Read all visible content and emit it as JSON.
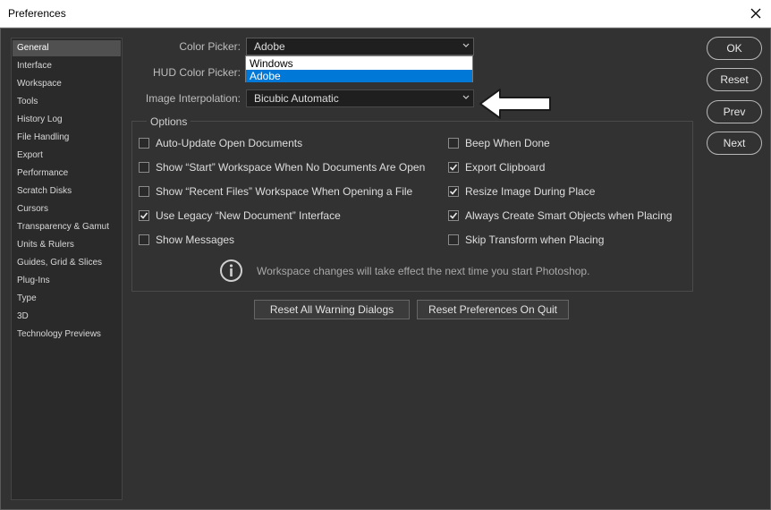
{
  "window": {
    "title": "Preferences"
  },
  "sidebar": {
    "items": [
      {
        "label": "General",
        "selected": true
      },
      {
        "label": "Interface"
      },
      {
        "label": "Workspace"
      },
      {
        "label": "Tools"
      },
      {
        "label": "History Log"
      },
      {
        "label": "File Handling"
      },
      {
        "label": "Export"
      },
      {
        "label": "Performance"
      },
      {
        "label": "Scratch Disks"
      },
      {
        "label": "Cursors"
      },
      {
        "label": "Transparency & Gamut"
      },
      {
        "label": "Units & Rulers"
      },
      {
        "label": "Guides, Grid & Slices"
      },
      {
        "label": "Plug-Ins"
      },
      {
        "label": "Type"
      },
      {
        "label": "3D"
      },
      {
        "label": "Technology Previews"
      }
    ]
  },
  "fields": {
    "color_picker": {
      "label": "Color Picker:",
      "value": "Adobe",
      "options": [
        "Windows",
        "Adobe"
      ],
      "selected_option": "Adobe",
      "open": true
    },
    "hud_color_picker": {
      "label": "HUD Color Picker:"
    },
    "image_interpolation": {
      "label": "Image Interpolation:",
      "value": "Bicubic Automatic"
    }
  },
  "options": {
    "legend": "Options",
    "left": [
      {
        "label": "Auto-Update Open Documents",
        "checked": false
      },
      {
        "label": "Show “Start” Workspace When No Documents Are Open",
        "checked": false
      },
      {
        "label": "Show “Recent Files” Workspace When Opening a File",
        "checked": false
      },
      {
        "label": "Use Legacy “New Document” Interface",
        "checked": true
      },
      {
        "label": "Show Messages",
        "checked": false
      }
    ],
    "right": [
      {
        "label": "Beep When Done",
        "checked": false
      },
      {
        "label": "Export Clipboard",
        "checked": true
      },
      {
        "label": "Resize Image During Place",
        "checked": true
      },
      {
        "label": "Always Create Smart Objects when Placing",
        "checked": true
      },
      {
        "label": "Skip Transform when Placing",
        "checked": false
      }
    ],
    "info_text": "Workspace changes will take effect the next time you start Photoshop."
  },
  "bottom_buttons": {
    "reset_warnings": "Reset All Warning Dialogs",
    "reset_on_quit": "Reset Preferences On Quit"
  },
  "right_buttons": {
    "ok": "OK",
    "reset": "Reset",
    "prev": "Prev",
    "next": "Next"
  },
  "icons": {
    "close": "close-icon",
    "info": "info-icon",
    "arrow": "arrow-left-icon",
    "chevron": "chevron-down-icon",
    "check": "checkmark-icon"
  },
  "colors": {
    "dialog_bg": "#323232",
    "selection_blue": "#0078d7"
  }
}
